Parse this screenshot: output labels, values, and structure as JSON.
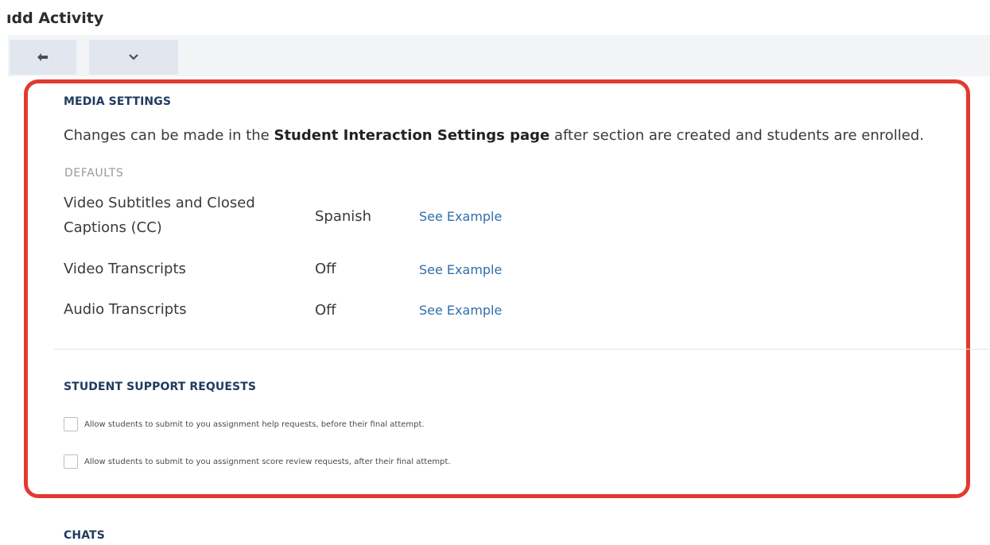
{
  "page": {
    "title": "ıdd Activity"
  },
  "toolbar": {
    "back_icon": "arrow-left-icon",
    "expand_icon": "chevron-down-icon"
  },
  "media_settings": {
    "heading": "MEDIA SETTINGS",
    "intro_prefix": "Changes can be made in the ",
    "intro_bold": "Student Interaction Settings page",
    "intro_suffix": " after section are created and students are enrolled.",
    "defaults_label": "DEFAULTS",
    "rows": [
      {
        "name": "Video Subtitles and Closed Captions (CC)",
        "value": "Spanish",
        "link": "See Example"
      },
      {
        "name": "Video Transcripts",
        "value": "Off",
        "link": "See Example"
      },
      {
        "name": "Audio Transcripts",
        "value": "Off",
        "link": "See Example"
      }
    ]
  },
  "support_requests": {
    "heading": "STUDENT SUPPORT REQUESTS",
    "options": [
      {
        "label": "Allow students to submit to you assignment help requests, before their final attempt.",
        "checked": false
      },
      {
        "label": "Allow students to submit to you assignment score review requests, after their final attempt.",
        "checked": false
      }
    ]
  },
  "chats": {
    "heading": "CHATS"
  },
  "colors": {
    "highlight": "#e23a30",
    "heading": "#1f3b5e",
    "link": "#2f6fa8"
  }
}
